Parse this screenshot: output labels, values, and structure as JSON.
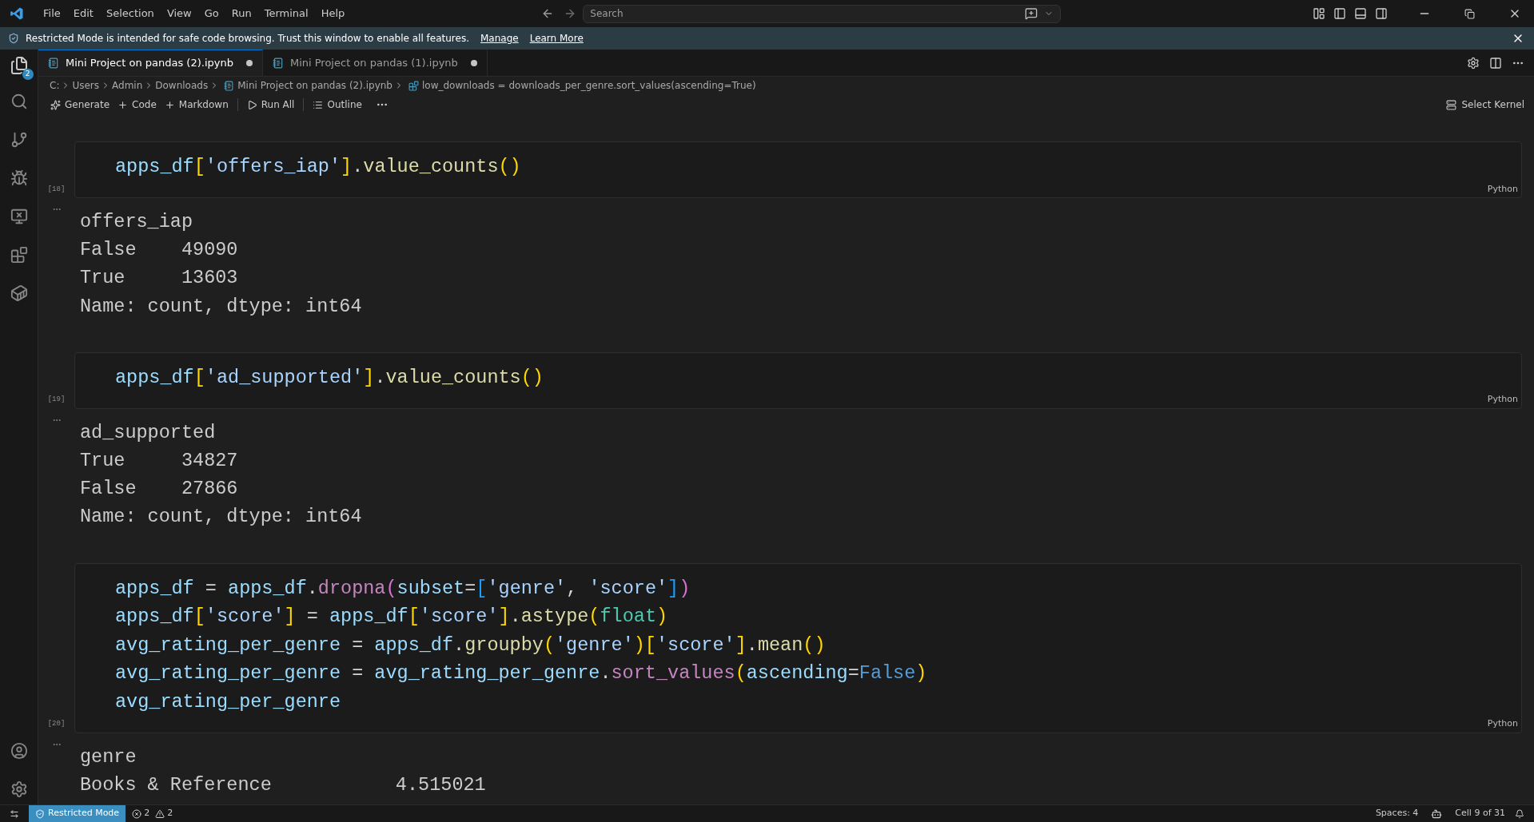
{
  "menu": [
    "File",
    "Edit",
    "Selection",
    "View",
    "Go",
    "Run",
    "Terminal",
    "Help"
  ],
  "search": {
    "placeholder": "Search"
  },
  "banner": {
    "text": "Restricted Mode is intended for safe code browsing. Trust this window to enable all features.",
    "links": [
      "Manage",
      "Learn More"
    ]
  },
  "activity_badge": "2",
  "tabs": [
    {
      "label": "Mini Project on pandas (2).ipynb",
      "selected": true,
      "modified": true
    },
    {
      "label": "Mini Project on pandas (1).ipynb",
      "selected": false,
      "modified": true
    }
  ],
  "breadcrumb": [
    {
      "label": "C:",
      "kind": "folder"
    },
    {
      "label": "Users",
      "kind": "folder"
    },
    {
      "label": "Admin",
      "kind": "folder"
    },
    {
      "label": "Downloads",
      "kind": "folder"
    },
    {
      "label": "Mini Project on pandas (2).ipynb",
      "kind": "notebook"
    },
    {
      "label": "low_downloads = downloads_per_genre.sort_values(ascending=True)",
      "kind": "cell"
    }
  ],
  "toolbar": [
    {
      "label": "Generate",
      "kind": "sparkle"
    },
    {
      "label": "Code",
      "kind": "plus"
    },
    {
      "label": "Markdown",
      "kind": "plus"
    },
    {
      "label": "Run All",
      "kind": "run"
    },
    {
      "label": "Outline",
      "kind": "list"
    }
  ],
  "kernel": "Select Kernel",
  "cells": [
    {
      "count": "[18]",
      "language": "Python",
      "code": [
        [
          {
            "t": "apps_df",
            "kind": "var"
          },
          {
            "t": "[",
            "kind": "b1"
          },
          {
            "t": "'offers_iap'",
            "kind": "str"
          },
          {
            "t": "]",
            "kind": "b1"
          },
          {
            "t": ".",
            "kind": "plain"
          },
          {
            "t": "value_counts",
            "kind": "func"
          },
          {
            "t": "()",
            "kind": "b1"
          }
        ]
      ],
      "output": [
        "offers_iap",
        "False    49090",
        "True     13603",
        "Name: count, dtype: int64"
      ]
    },
    {
      "count": "[19]",
      "language": "Python",
      "code": [
        [
          {
            "t": "apps_df",
            "kind": "var"
          },
          {
            "t": "[",
            "kind": "b1"
          },
          {
            "t": "'ad_supported'",
            "kind": "str"
          },
          {
            "t": "]",
            "kind": "b1"
          },
          {
            "t": ".",
            "kind": "plain"
          },
          {
            "t": "value_counts",
            "kind": "func"
          },
          {
            "t": "()",
            "kind": "b1"
          }
        ]
      ],
      "output": [
        "ad_supported",
        "True     34827",
        "False    27866",
        "Name: count, dtype: int64"
      ]
    },
    {
      "count": "[20]",
      "language": "Python",
      "code": [
        [
          {
            "t": "apps_df",
            "kind": "var"
          },
          {
            "t": " = ",
            "kind": "plain"
          },
          {
            "t": "apps_df",
            "kind": "var"
          },
          {
            "t": ".",
            "kind": "plain"
          },
          {
            "t": "dropna",
            "kind": "method"
          },
          {
            "t": "(",
            "kind": "b2"
          },
          {
            "t": "subset",
            "kind": "var"
          },
          {
            "t": "=",
            "kind": "plain"
          },
          {
            "t": "[",
            "kind": "b3"
          },
          {
            "t": "'genre'",
            "kind": "str"
          },
          {
            "t": ", ",
            "kind": "plain"
          },
          {
            "t": "'score'",
            "kind": "str"
          },
          {
            "t": "]",
            "kind": "b3"
          },
          {
            "t": ")",
            "kind": "b2"
          }
        ],
        [
          {
            "t": "apps_df",
            "kind": "var"
          },
          {
            "t": "[",
            "kind": "b1"
          },
          {
            "t": "'score'",
            "kind": "str"
          },
          {
            "t": "]",
            "kind": "b1"
          },
          {
            "t": " = ",
            "kind": "plain"
          },
          {
            "t": "apps_df",
            "kind": "var"
          },
          {
            "t": "[",
            "kind": "b1"
          },
          {
            "t": "'score'",
            "kind": "str"
          },
          {
            "t": "]",
            "kind": "b1"
          },
          {
            "t": ".",
            "kind": "plain"
          },
          {
            "t": "astype",
            "kind": "func"
          },
          {
            "t": "(",
            "kind": "b1"
          },
          {
            "t": "float",
            "kind": "type"
          },
          {
            "t": ")",
            "kind": "b1"
          }
        ],
        [
          {
            "t": "avg_rating_per_genre",
            "kind": "var"
          },
          {
            "t": " = ",
            "kind": "plain"
          },
          {
            "t": "apps_df",
            "kind": "var"
          },
          {
            "t": ".",
            "kind": "plain"
          },
          {
            "t": "groupby",
            "kind": "func"
          },
          {
            "t": "(",
            "kind": "b1"
          },
          {
            "t": "'genre'",
            "kind": "str"
          },
          {
            "t": ")",
            "kind": "b1"
          },
          {
            "t": "[",
            "kind": "b1"
          },
          {
            "t": "'score'",
            "kind": "str"
          },
          {
            "t": "]",
            "kind": "b1"
          },
          {
            "t": ".",
            "kind": "plain"
          },
          {
            "t": "mean",
            "kind": "func"
          },
          {
            "t": "()",
            "kind": "b1"
          }
        ],
        [
          {
            "t": "avg_rating_per_genre",
            "kind": "var"
          },
          {
            "t": " = ",
            "kind": "plain"
          },
          {
            "t": "avg_rating_per_genre",
            "kind": "var"
          },
          {
            "t": ".",
            "kind": "plain"
          },
          {
            "t": "sort_values",
            "kind": "method"
          },
          {
            "t": "(",
            "kind": "b1"
          },
          {
            "t": "ascending",
            "kind": "param"
          },
          {
            "t": "=",
            "kind": "plain"
          },
          {
            "t": "False",
            "kind": "kw"
          },
          {
            "t": ")",
            "kind": "b1"
          }
        ],
        [
          {
            "t": "avg_rating_per_genre",
            "kind": "var"
          }
        ]
      ],
      "output": [
        "genre",
        "Books & Reference           4.515021"
      ]
    }
  ],
  "status_bar": {
    "mode": "Restricted Mode",
    "errors": "2",
    "warnings": "2",
    "spaces": "Spaces: 4",
    "cell": "Cell 9 of 31"
  }
}
